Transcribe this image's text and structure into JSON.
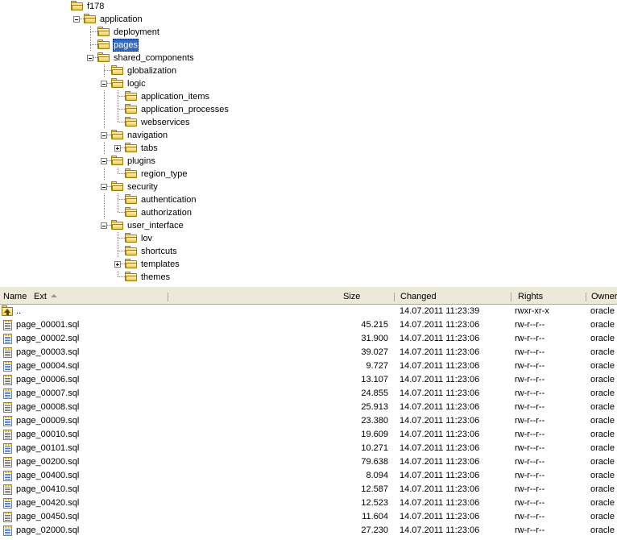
{
  "tree": {
    "root_label": "f178",
    "selected": "pages",
    "nodes": [
      {
        "label": "f178",
        "depth": 0,
        "toggle": "none",
        "icon": "folder-icon"
      },
      {
        "label": "application",
        "depth": 1,
        "toggle": "minus",
        "icon": "folder-icon"
      },
      {
        "label": "deployment",
        "depth": 2,
        "toggle": "leaf",
        "icon": "folder-icon"
      },
      {
        "label": "pages",
        "depth": 2,
        "toggle": "leaf",
        "icon": "folder-icon"
      },
      {
        "label": "shared_components",
        "depth": 2,
        "toggle": "minus",
        "icon": "folder-icon"
      },
      {
        "label": "globalization",
        "depth": 3,
        "toggle": "leaf",
        "icon": "folder-icon"
      },
      {
        "label": "logic",
        "depth": 3,
        "toggle": "minus",
        "icon": "folder-icon"
      },
      {
        "label": "application_items",
        "depth": 4,
        "toggle": "leaf",
        "icon": "folder-icon"
      },
      {
        "label": "application_processes",
        "depth": 4,
        "toggle": "leaf",
        "icon": "folder-icon"
      },
      {
        "label": "webservices",
        "depth": 4,
        "toggle": "leaf",
        "icon": "folder-icon"
      },
      {
        "label": "navigation",
        "depth": 3,
        "toggle": "minus",
        "icon": "folder-icon"
      },
      {
        "label": "tabs",
        "depth": 4,
        "toggle": "plus",
        "icon": "folder-icon"
      },
      {
        "label": "plugins",
        "depth": 3,
        "toggle": "minus",
        "icon": "folder-icon"
      },
      {
        "label": "region_type",
        "depth": 4,
        "toggle": "leaf",
        "icon": "folder-icon"
      },
      {
        "label": "security",
        "depth": 3,
        "toggle": "minus",
        "icon": "folder-icon"
      },
      {
        "label": "authentication",
        "depth": 4,
        "toggle": "leaf",
        "icon": "folder-icon"
      },
      {
        "label": "authorization",
        "depth": 4,
        "toggle": "leaf",
        "icon": "folder-icon"
      },
      {
        "label": "user_interface",
        "depth": 3,
        "toggle": "minus",
        "icon": "folder-icon"
      },
      {
        "label": "lov",
        "depth": 4,
        "toggle": "leaf",
        "icon": "folder-icon"
      },
      {
        "label": "shortcuts",
        "depth": 4,
        "toggle": "leaf",
        "icon": "folder-icon"
      },
      {
        "label": "templates",
        "depth": 4,
        "toggle": "plus",
        "icon": "folder-icon"
      },
      {
        "label": "themes",
        "depth": 4,
        "toggle": "leaf",
        "icon": "folder-icon"
      }
    ]
  },
  "file_list": {
    "columns": [
      {
        "key": "name",
        "label": "Name",
        "sorted": false
      },
      {
        "key": "ext",
        "label": "Ext",
        "sorted": true,
        "sort_direction": "asc"
      },
      {
        "key": "size",
        "label": "Size",
        "sorted": false
      },
      {
        "key": "changed",
        "label": "Changed",
        "sorted": false
      },
      {
        "key": "rights",
        "label": "Rights",
        "sorted": false
      },
      {
        "key": "owner",
        "label": "Owner",
        "sorted": false
      }
    ],
    "rows": [
      {
        "icon": "parent-dir-icon",
        "name": "..",
        "size": "",
        "changed": "14.07.2011 11:23:39",
        "rights": "rwxr-xr-x",
        "owner": "oracle"
      },
      {
        "icon": "sql-file-icon",
        "name": "page_00001.sql",
        "size": "45.215",
        "changed": "14.07.2011 11:23:06",
        "rights": "rw-r--r--",
        "owner": "oracle"
      },
      {
        "icon": "sql-file-icon",
        "name": "page_00002.sql",
        "size": "31.900",
        "changed": "14.07.2011 11:23:06",
        "rights": "rw-r--r--",
        "owner": "oracle"
      },
      {
        "icon": "sql-file-icon",
        "name": "page_00003.sql",
        "size": "39.027",
        "changed": "14.07.2011 11:23:06",
        "rights": "rw-r--r--",
        "owner": "oracle"
      },
      {
        "icon": "sql-file-icon",
        "name": "page_00004.sql",
        "size": "9.727",
        "changed": "14.07.2011 11:23:06",
        "rights": "rw-r--r--",
        "owner": "oracle"
      },
      {
        "icon": "sql-file-icon",
        "name": "page_00006.sql",
        "size": "13.107",
        "changed": "14.07.2011 11:23:06",
        "rights": "rw-r--r--",
        "owner": "oracle"
      },
      {
        "icon": "sql-file-icon",
        "name": "page_00007.sql",
        "size": "24.855",
        "changed": "14.07.2011 11:23:06",
        "rights": "rw-r--r--",
        "owner": "oracle"
      },
      {
        "icon": "sql-file-icon",
        "name": "page_00008.sql",
        "size": "25.913",
        "changed": "14.07.2011 11:23:06",
        "rights": "rw-r--r--",
        "owner": "oracle"
      },
      {
        "icon": "sql-file-icon",
        "name": "page_00009.sql",
        "size": "23.380",
        "changed": "14.07.2011 11:23:06",
        "rights": "rw-r--r--",
        "owner": "oracle"
      },
      {
        "icon": "sql-file-icon",
        "name": "page_00010.sql",
        "size": "19.609",
        "changed": "14.07.2011 11:23:06",
        "rights": "rw-r--r--",
        "owner": "oracle"
      },
      {
        "icon": "sql-file-icon",
        "name": "page_00101.sql",
        "size": "10.271",
        "changed": "14.07.2011 11:23:06",
        "rights": "rw-r--r--",
        "owner": "oracle"
      },
      {
        "icon": "sql-file-icon",
        "name": "page_00200.sql",
        "size": "79.638",
        "changed": "14.07.2011 11:23:06",
        "rights": "rw-r--r--",
        "owner": "oracle"
      },
      {
        "icon": "sql-file-icon",
        "name": "page_00400.sql",
        "size": "8.094",
        "changed": "14.07.2011 11:23:06",
        "rights": "rw-r--r--",
        "owner": "oracle"
      },
      {
        "icon": "sql-file-icon",
        "name": "page_00410.sql",
        "size": "12.587",
        "changed": "14.07.2011 11:23:06",
        "rights": "rw-r--r--",
        "owner": "oracle"
      },
      {
        "icon": "sql-file-icon",
        "name": "page_00420.sql",
        "size": "12.523",
        "changed": "14.07.2011 11:23:06",
        "rights": "rw-r--r--",
        "owner": "oracle"
      },
      {
        "icon": "sql-file-icon",
        "name": "page_00450.sql",
        "size": "11.604",
        "changed": "14.07.2011 11:23:06",
        "rights": "rw-r--r--",
        "owner": "oracle"
      },
      {
        "icon": "sql-file-icon",
        "name": "page_02000.sql",
        "size": "27.230",
        "changed": "14.07.2011 11:23:06",
        "rights": "rw-r--r--",
        "owner": "oracle"
      }
    ]
  },
  "colors": {
    "selection": "#316ac5",
    "header_bg": "#ece9d8",
    "header_border": "#aca899",
    "folder": "#f3cf55",
    "tree_guide": "#808080"
  }
}
